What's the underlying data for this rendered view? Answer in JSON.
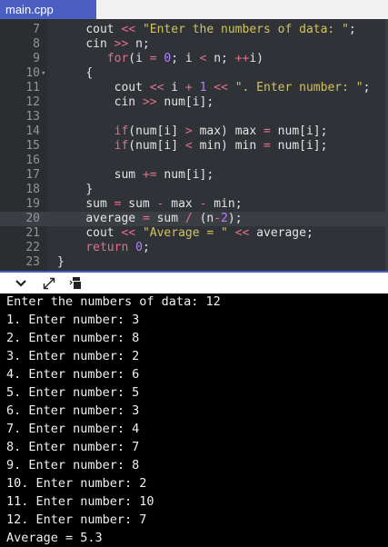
{
  "tab": {
    "label": "main.cpp"
  },
  "editor": {
    "lines": [
      {
        "num": "7",
        "fold": "",
        "indent": "    ",
        "tokens": [
          [
            "cout ",
            "plain"
          ],
          [
            "<< ",
            "op"
          ],
          [
            "\"Enter the numbers of data: \"",
            "str"
          ],
          [
            ";",
            "plain"
          ]
        ]
      },
      {
        "num": "8",
        "fold": "",
        "indent": "    ",
        "tokens": [
          [
            "cin ",
            "plain"
          ],
          [
            ">> ",
            "op"
          ],
          [
            "n;",
            "plain"
          ]
        ]
      },
      {
        "num": "9",
        "fold": "",
        "indent": "       ",
        "tokens": [
          [
            "for",
            "kw"
          ],
          [
            "(i ",
            "plain"
          ],
          [
            "= ",
            "op"
          ],
          [
            "0",
            "num"
          ],
          [
            "; i ",
            "plain"
          ],
          [
            "< ",
            "op"
          ],
          [
            "n; ",
            "plain"
          ],
          [
            "++",
            "op"
          ],
          [
            "i)",
            "plain"
          ]
        ]
      },
      {
        "num": "10",
        "fold": "▾",
        "indent": "    ",
        "tokens": [
          [
            "{",
            "plain"
          ]
        ]
      },
      {
        "num": "11",
        "fold": "",
        "indent": "        ",
        "tokens": [
          [
            "cout ",
            "plain"
          ],
          [
            "<< ",
            "op"
          ],
          [
            "i ",
            "plain"
          ],
          [
            "+ ",
            "op"
          ],
          [
            "1 ",
            "num"
          ],
          [
            "<< ",
            "op"
          ],
          [
            "\". Enter number: \"",
            "str"
          ],
          [
            ";",
            "plain"
          ]
        ]
      },
      {
        "num": "12",
        "fold": "",
        "indent": "        ",
        "tokens": [
          [
            "cin ",
            "plain"
          ],
          [
            ">> ",
            "op"
          ],
          [
            "num[i];",
            "plain"
          ]
        ]
      },
      {
        "num": "13",
        "fold": "",
        "indent": "",
        "tokens": []
      },
      {
        "num": "14",
        "fold": "",
        "indent": "        ",
        "tokens": [
          [
            "if",
            "kw"
          ],
          [
            "(num[i] ",
            "plain"
          ],
          [
            "> ",
            "op"
          ],
          [
            "max) max ",
            "plain"
          ],
          [
            "= ",
            "op"
          ],
          [
            "num[i];",
            "plain"
          ]
        ]
      },
      {
        "num": "15",
        "fold": "",
        "indent": "        ",
        "tokens": [
          [
            "if",
            "kw"
          ],
          [
            "(num[i] ",
            "plain"
          ],
          [
            "< ",
            "op"
          ],
          [
            "min) min ",
            "plain"
          ],
          [
            "= ",
            "op"
          ],
          [
            "num[i];",
            "plain"
          ]
        ]
      },
      {
        "num": "16",
        "fold": "",
        "indent": "",
        "tokens": []
      },
      {
        "num": "17",
        "fold": "",
        "indent": "        ",
        "tokens": [
          [
            "sum ",
            "plain"
          ],
          [
            "+= ",
            "op"
          ],
          [
            "num[i];",
            "plain"
          ]
        ]
      },
      {
        "num": "18",
        "fold": "",
        "indent": "    ",
        "tokens": [
          [
            "}",
            "plain"
          ]
        ]
      },
      {
        "num": "19",
        "fold": "",
        "indent": "    ",
        "tokens": [
          [
            "sum ",
            "plain"
          ],
          [
            "= ",
            "op"
          ],
          [
            "sum ",
            "plain"
          ],
          [
            "- ",
            "op"
          ],
          [
            "max ",
            "plain"
          ],
          [
            "- ",
            "op"
          ],
          [
            "min;",
            "plain"
          ]
        ]
      },
      {
        "num": "20",
        "fold": "",
        "indent": "    ",
        "active": true,
        "tokens": [
          [
            "average ",
            "plain"
          ],
          [
            "= ",
            "op"
          ],
          [
            "sum ",
            "plain"
          ],
          [
            "/ ",
            "op"
          ],
          [
            "(n",
            "plain"
          ],
          [
            "-",
            "op"
          ],
          [
            "2",
            "num"
          ],
          [
            ");",
            "plain"
          ]
        ]
      },
      {
        "num": "21",
        "fold": "",
        "indent": "    ",
        "tokens": [
          [
            "cout ",
            "plain"
          ],
          [
            "<< ",
            "op"
          ],
          [
            "\"Average = \" ",
            "str"
          ],
          [
            "<< ",
            "op"
          ],
          [
            "average;",
            "plain"
          ]
        ]
      },
      {
        "num": "22",
        "fold": "",
        "indent": "    ",
        "tokens": [
          [
            "return ",
            "kw"
          ],
          [
            "0",
            "num"
          ],
          [
            ";",
            "plain"
          ]
        ]
      },
      {
        "num": "23",
        "fold": "",
        "indent": "",
        "tokens": [
          [
            "}",
            "plain"
          ]
        ]
      }
    ]
  },
  "toolbar": {
    "buttons": [
      {
        "name": "collapse-console-icon"
      },
      {
        "name": "expand-console-icon"
      },
      {
        "name": "copy-output-icon"
      }
    ]
  },
  "console": {
    "lines": [
      "Enter the numbers of data: 12",
      "1. Enter number: 3",
      "2. Enter number: 8",
      "3. Enter number: 2",
      "4. Enter number: 6",
      "5. Enter number: 5",
      "6. Enter number: 3",
      "7. Enter number: 4",
      "8. Enter number: 7",
      "9. Enter number: 8",
      "10. Enter number: 2",
      "11. Enter number: 10",
      "12. Enter number: 7",
      "Average = 5.3"
    ]
  }
}
